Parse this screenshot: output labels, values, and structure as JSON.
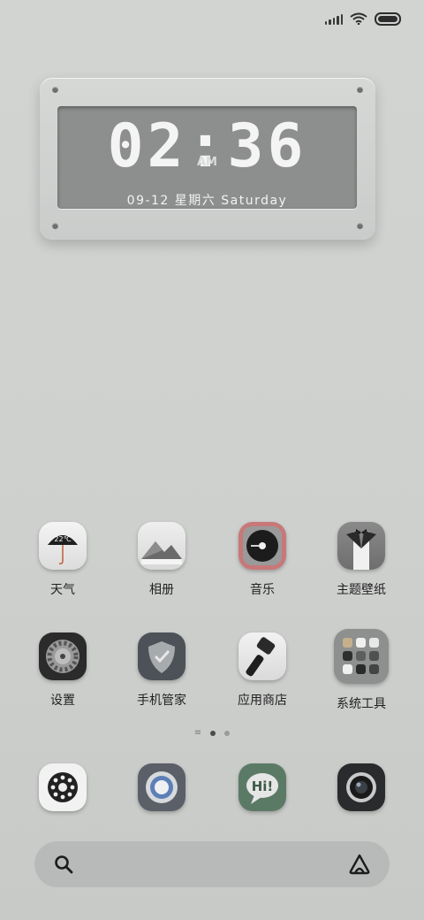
{
  "status_bar": {
    "battery_icon": "battery-icon",
    "wifi_icon": "wifi-icon",
    "signal_icon": "signal-icon"
  },
  "clock": {
    "hours": "02",
    "minutes": "36",
    "ampm": "AM",
    "date": "09-12 星期六 Saturday"
  },
  "apps_row1": [
    {
      "label": "天气",
      "icon": "umbrella-weather-icon",
      "temp": "22℃"
    },
    {
      "label": "相册",
      "icon": "mountain-photo-icon"
    },
    {
      "label": "音乐",
      "icon": "record-player-icon"
    },
    {
      "label": "主题壁纸",
      "icon": "tuxedo-icon"
    }
  ],
  "apps_row2": [
    {
      "label": "设置",
      "icon": "gear-icon"
    },
    {
      "label": "手机管家",
      "icon": "shield-check-icon"
    },
    {
      "label": "应用商店",
      "icon": "hammer-store-icon"
    },
    {
      "label": "系统工具",
      "icon": "folder-icon"
    }
  ],
  "page_indicator": {
    "total": 2,
    "active": 0
  },
  "dock": [
    {
      "name": "phone",
      "icon": "rotary-dial-icon"
    },
    {
      "name": "browser",
      "icon": "browser-ring-icon"
    },
    {
      "name": "messages",
      "icon": "hi-chat-icon",
      "text": "Hi!"
    },
    {
      "name": "camera",
      "icon": "camera-lens-icon"
    }
  ],
  "search_bar": {
    "search_icon": "search-icon",
    "assistant_icon": "assistant-a-icon"
  }
}
